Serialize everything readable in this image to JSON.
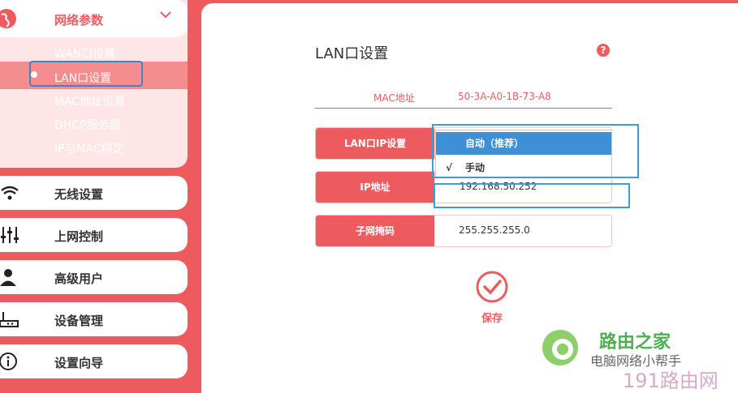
{
  "sidebar": {
    "group_open": {
      "label": "网络参数"
    },
    "sub_items": [
      "WAN口设置",
      "LAN口设置",
      "MAC地址设置",
      "DHCP服务器",
      "IP与MAC绑定"
    ],
    "active_sub": 1,
    "items": [
      {
        "label": "无线设置",
        "icon": "wifi-icon"
      },
      {
        "label": "上网控制",
        "icon": "sliders-icon"
      },
      {
        "label": "高级用户",
        "icon": "user-icon"
      },
      {
        "label": "设备管理",
        "icon": "device-icon"
      },
      {
        "label": "设置向导",
        "icon": "info-icon"
      }
    ]
  },
  "main": {
    "title": "LAN口设置",
    "help": "?",
    "mac": {
      "label": "MAC地址",
      "value": "50-3A-A0-1B-73-A8"
    },
    "fields": {
      "lan_ip_mode": {
        "label": "LAN口IP设置",
        "options": [
          "自动（推荐）",
          "手动"
        ],
        "selected": "自动（推荐）",
        "checked": "手动",
        "check_mark": "√"
      },
      "ip": {
        "label": "IP地址",
        "value": "192.168.50.252"
      },
      "mask": {
        "label": "子网掩码",
        "value": "255.255.255.0"
      }
    },
    "save_label": "保存"
  },
  "watermark": {
    "line1": "路由之家",
    "line2": "电脑网络小帮手",
    "line3": "191路由网"
  },
  "colors": {
    "brand": "#ee5b5f",
    "highlight": "#3d8fd6"
  }
}
